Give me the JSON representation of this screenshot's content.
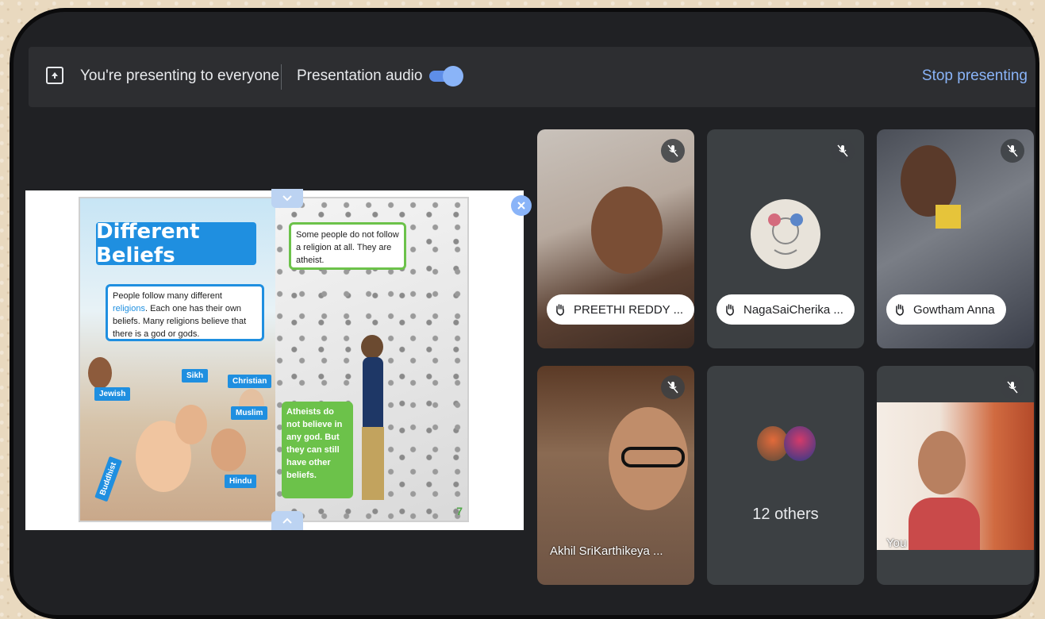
{
  "topbar": {
    "presenting_label": "You're presenting to everyone",
    "audio_label": "Presentation audio",
    "audio_on": true,
    "stop_label": "Stop presenting"
  },
  "slide": {
    "title": "Different Beliefs",
    "desc_part1": "People follow many different ",
    "desc_highlight": "religions",
    "desc_part2": ". Each one has their own beliefs. Many religions believe that there is a god or gods.",
    "atheist_note": "Some people do not follow a religion at all. They are atheist.",
    "green_note": "Atheists do not believe in any god. But they can still have other beliefs.",
    "tags": {
      "sikh": "Sikh",
      "christian": "Christian",
      "jewish": "Jewish",
      "muslim": "Muslim",
      "buddhist": "Buddhist",
      "hindu": "Hindu"
    },
    "page_number": "7"
  },
  "participants": {
    "preethi": "PREETHI REDDY ...",
    "naga": "NagaSaiCherika ...",
    "gowtham": "Gowtham Anna",
    "akhil": "Akhil SriKarthikeya ...",
    "others": "12 others",
    "you": "You"
  },
  "colors": {
    "accent": "#8ab4f8",
    "background": "#202124",
    "tile": "#3c4043"
  }
}
